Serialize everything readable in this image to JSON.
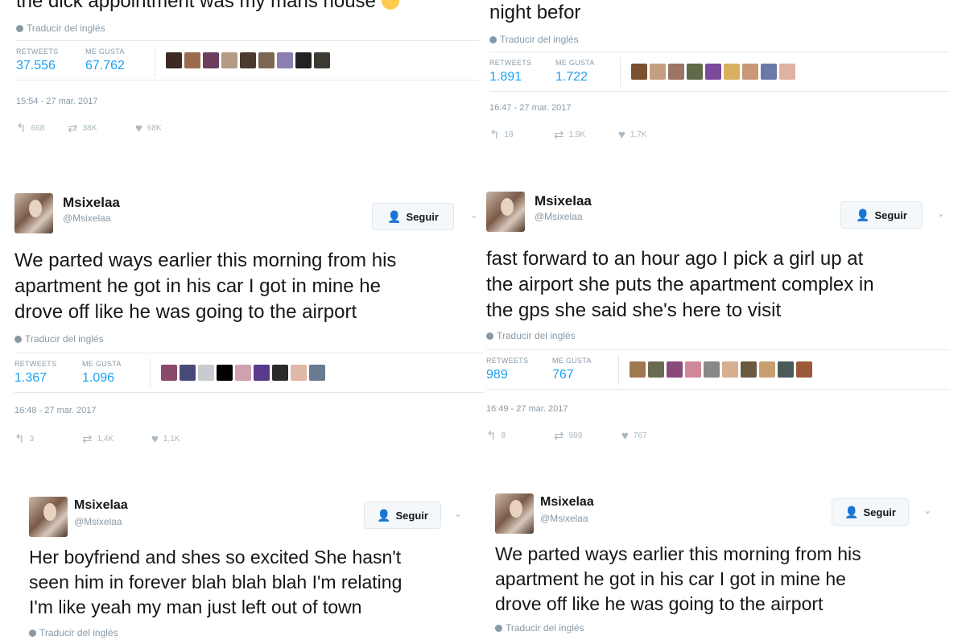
{
  "translate_label": "Traducir del inglés",
  "retweets_label": "RETWEETS",
  "likes_label": "ME GUSTA",
  "follow_label": "Seguir",
  "tweets": [
    {
      "text_lines": [
        "the dick appointment was my mans house"
      ],
      "retweets": "37.556",
      "likes": "67.762",
      "timestamp": "15:54 - 27 mar. 2017",
      "reply_count": "668",
      "retweet_count": "38K",
      "like_count": "68K"
    },
    {
      "text_lines": [
        "night befor"
      ],
      "retweets": "1.891",
      "likes": "1.722",
      "timestamp": "16:47 - 27 mar. 2017",
      "reply_count": "18",
      "retweet_count": "1,9K",
      "like_count": "1,7K"
    },
    {
      "name": "Msixelaa",
      "handle": "@Msixelaa",
      "text_lines": [
        "We parted ways earlier this morning from his",
        "apartment  he got in his car I got in mine he",
        "drove off like he was going  to the airport"
      ],
      "retweets": "1.367",
      "likes": "1.096",
      "timestamp": "16:48 - 27 mar. 2017",
      "reply_count": "3",
      "retweet_count": "1,4K",
      "like_count": "1,1K"
    },
    {
      "name": "Msixelaa",
      "handle": "@Msixelaa",
      "text_lines": [
        "fast forward to an hour ago I pick a girl up at",
        "the airport she puts the apartment complex in",
        "the gps she said she's here to visit"
      ],
      "retweets": "989",
      "likes": "767",
      "timestamp": "16:49 - 27 mar. 2017",
      "reply_count": "8",
      "retweet_count": "989",
      "like_count": "767"
    },
    {
      "name": "Msixelaa",
      "handle": "@Msixelaa",
      "text_lines": [
        "Her boyfriend and shes so excited She hasn't",
        "seen him in forever blah blah blah I'm relating",
        "I'm like yeah my man just left out of town"
      ]
    },
    {
      "name": "Msixelaa",
      "handle": "@Msixelaa",
      "text_lines": [
        "We parted ways earlier this morning from his",
        "apartment  he got in his car I got in mine he",
        "drove off like he was going  to the airport"
      ]
    }
  ],
  "colors": {
    "stat_blue": "#1da1f2",
    "muted_gray": "#8899a6",
    "divider": "#e1e8ed"
  },
  "icons": {
    "reply": "reply-icon",
    "retweet": "retweet-icon",
    "like": "heart-icon",
    "follow": "add-person-icon",
    "translate": "globe-icon",
    "caret": "chevron-down-icon"
  }
}
